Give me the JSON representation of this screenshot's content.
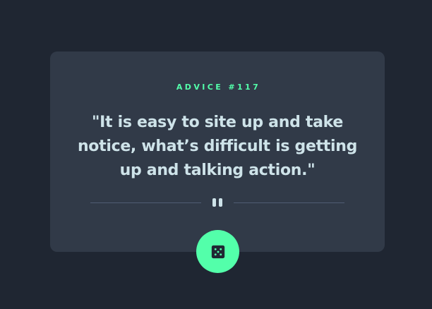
{
  "advice": {
    "id_label": "ADVICE #117",
    "quote": "\"It is easy to site up and take notice, what’s difficult is getting up and talking action.\""
  },
  "divider": {
    "icon": "pause-icon"
  },
  "dice_button": {
    "icon": "dice-icon"
  },
  "colors": {
    "background": "#1f2632",
    "card": "#313a48",
    "accent": "#53ffaa",
    "text": "#cee3e9",
    "divider": "#4f5d74"
  }
}
